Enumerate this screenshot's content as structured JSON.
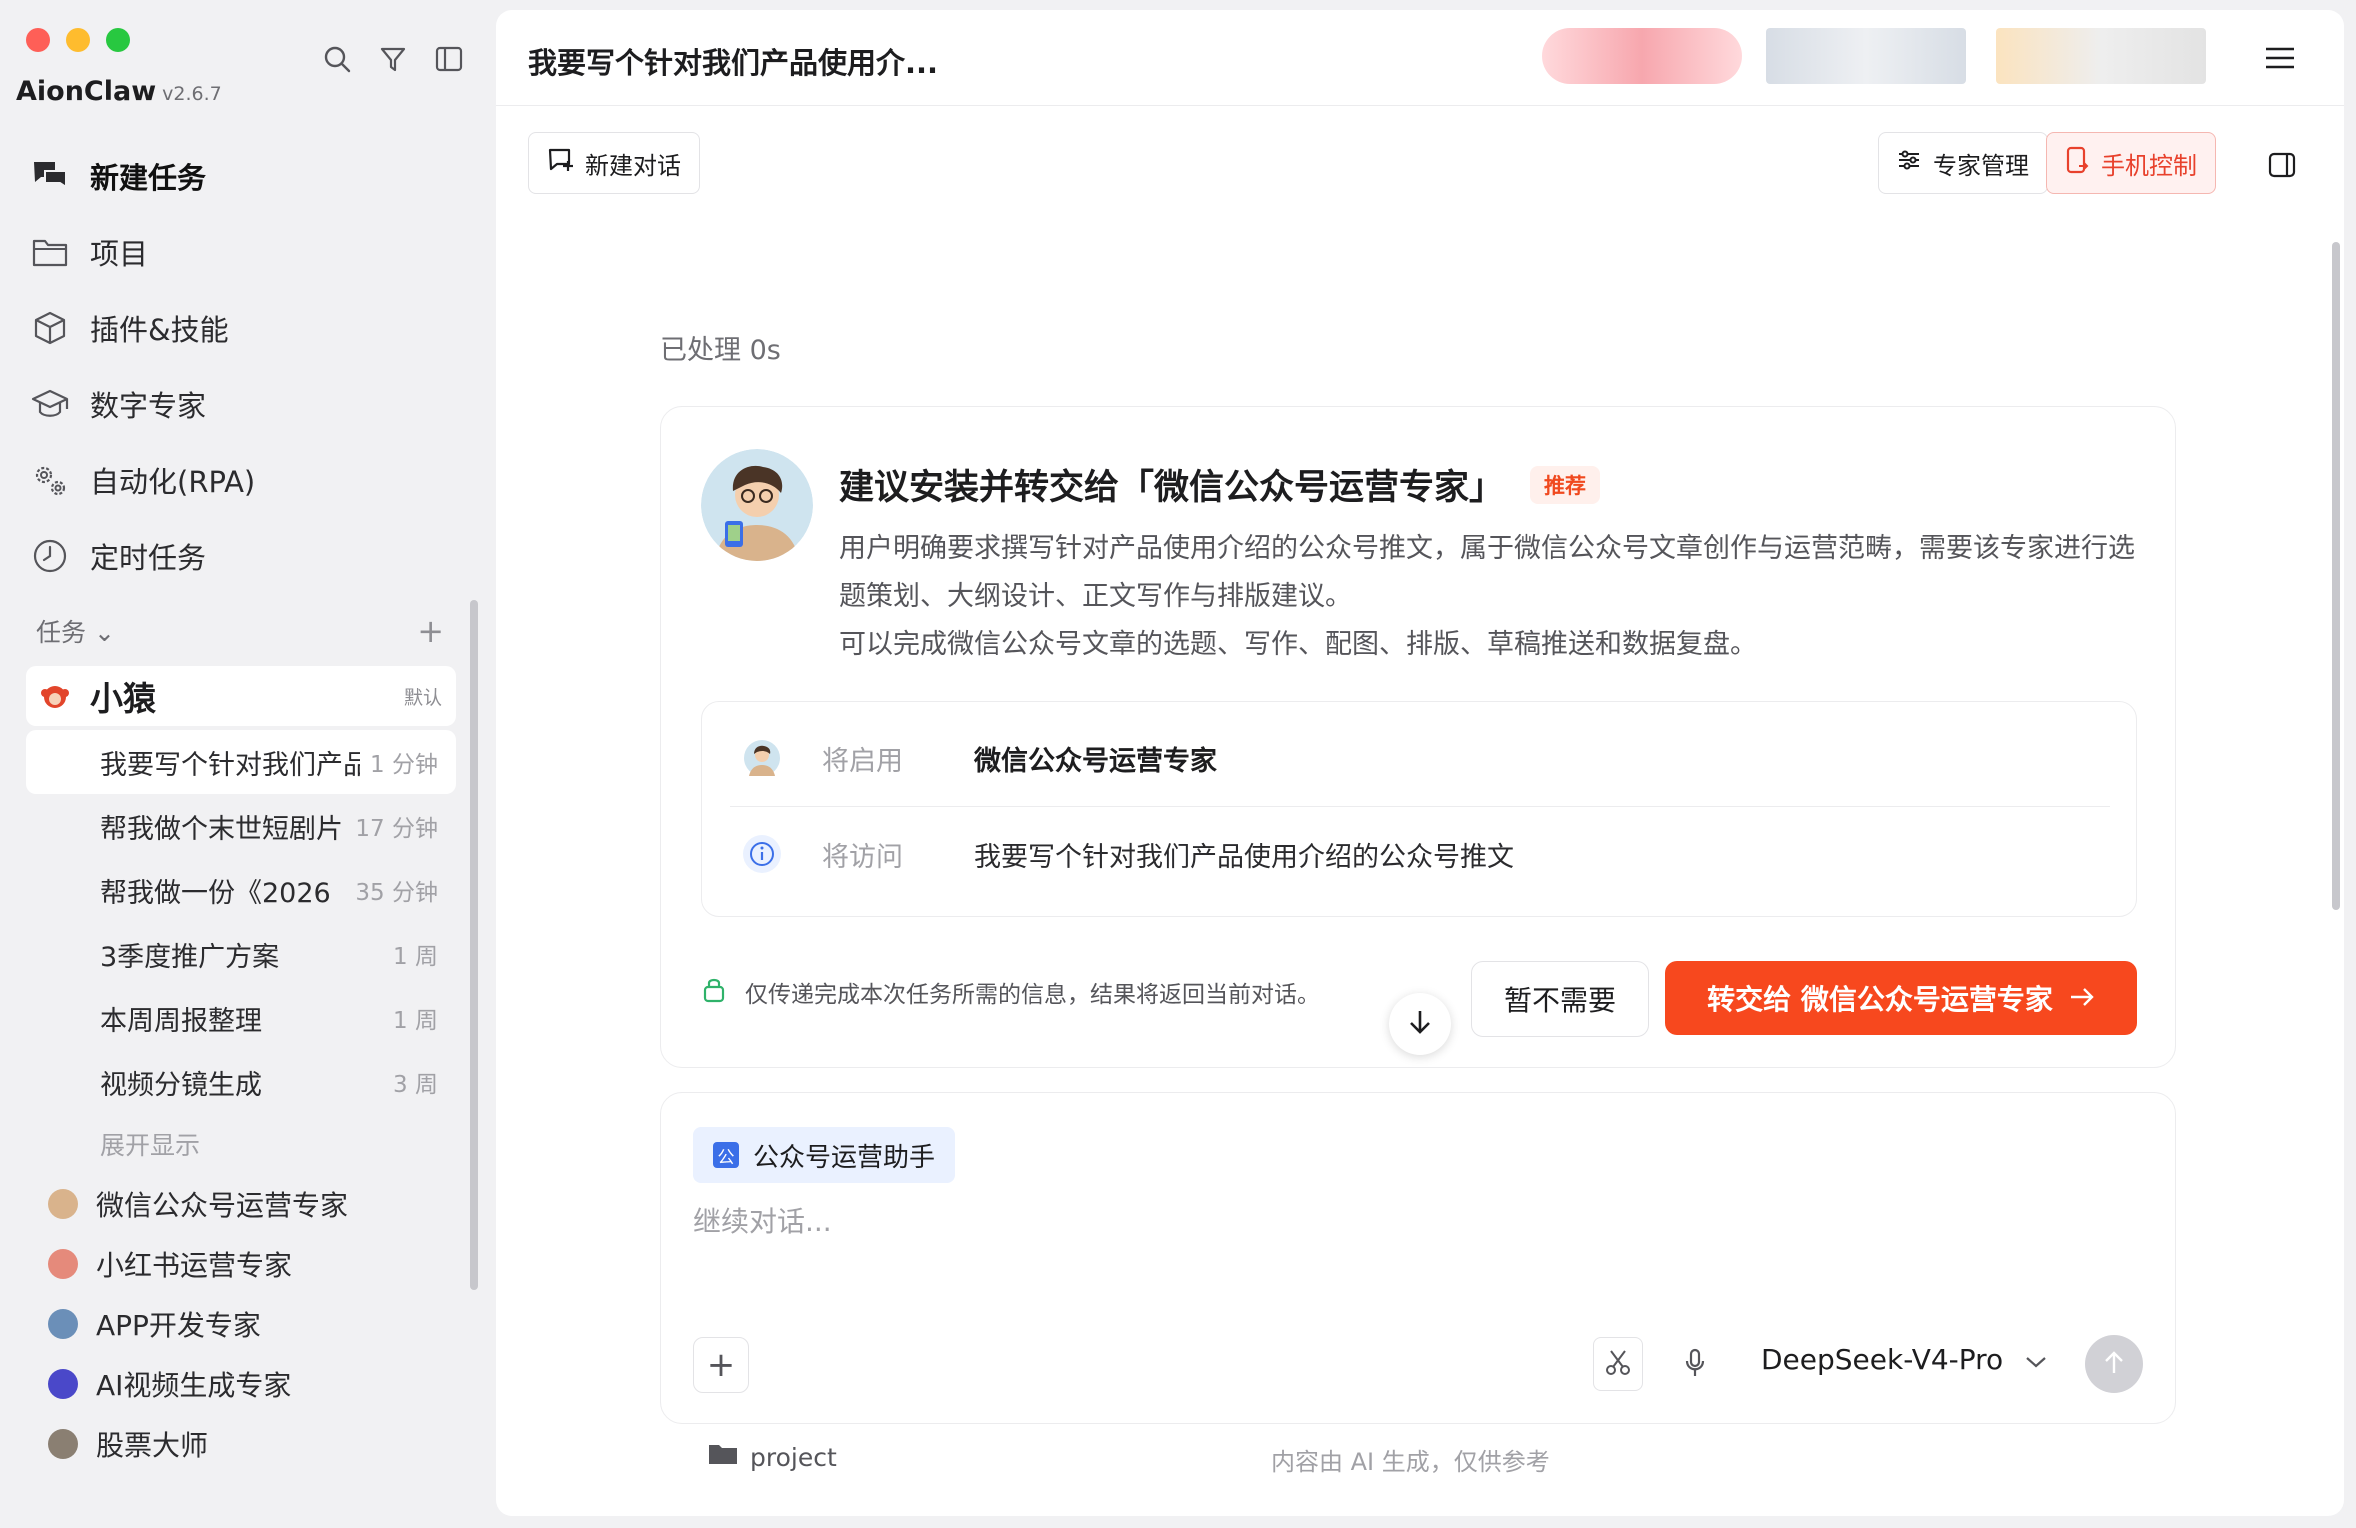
{
  "app": {
    "name": "AionClaw",
    "version": "v2.6.7"
  },
  "nav": [
    {
      "label": "新建任务",
      "icon": "chat-bubbles-icon"
    },
    {
      "label": "项目",
      "icon": "folder-icon"
    },
    {
      "label": "插件&技能",
      "icon": "cube-icon"
    },
    {
      "label": "数字专家",
      "icon": "graduation-cap-icon"
    },
    {
      "label": "自动化(RPA)",
      "icon": "gears-icon"
    },
    {
      "label": "定时任务",
      "icon": "clock-icon"
    }
  ],
  "tasks_section": {
    "title": "任务"
  },
  "group": {
    "name": "小猿",
    "tag": "默认"
  },
  "tasks": [
    {
      "name": "我要写个针对我们产品",
      "time": "1 分钟"
    },
    {
      "name": "帮我做个末世短剧片",
      "time": "17 分钟"
    },
    {
      "name": "帮我做一份《2026",
      "time": "35 分钟"
    },
    {
      "name": "3季度推广方案",
      "time": "1 周"
    },
    {
      "name": "本周周报整理",
      "time": "1 周"
    },
    {
      "name": "视频分镜生成",
      "time": "3 周"
    }
  ],
  "expand_label": "展开显示",
  "experts": [
    {
      "name": "微信公众号运营专家",
      "color": "#d9b38c"
    },
    {
      "name": "小红书运营专家",
      "color": "#e58a7b"
    },
    {
      "name": "APP开发专家",
      "color": "#6b8fb8"
    },
    {
      "name": "AI视频生成专家",
      "color": "#4a48c9"
    },
    {
      "name": "股票大师",
      "color": "#8a7f72"
    }
  ],
  "conversation": {
    "title": "我要写个针对我们产品使用介..."
  },
  "toolbar": {
    "new_chat": "新建对话",
    "expert_manage": "专家管理",
    "phone_control": "手机控制"
  },
  "processed": "已处理 0s",
  "card": {
    "title": "建议安装并转交给「微信公众号运营专家」",
    "badge": "推荐",
    "desc1": "用户明确要求撰写针对产品使用介绍的公众号推文，属于微信公众号文章创作与运营范畴，需要该专家进行选题策划、大纲设计、正文写作与排版建议。",
    "desc2": "可以完成微信公众号文章的选题、写作、配图、排版、草稿推送和数据复盘。",
    "enable_label": "将启用",
    "enable_value": "微信公众号运营专家",
    "visit_label": "将访问",
    "visit_value": "我要写个针对我们产品使用介绍的公众号推文",
    "privacy": "仅传递完成本次任务所需的信息，结果将返回当前对话。",
    "skip_button": "暂不需要",
    "transfer_button": "转交给 微信公众号运营专家"
  },
  "composer": {
    "chip": "公众号运营助手",
    "chip_icon": "公",
    "placeholder": "继续对话...",
    "model": "DeepSeek-V4-Pro"
  },
  "footer": {
    "project": "project",
    "note": "内容由 AI 生成，仅供参考"
  },
  "colors": {
    "accent": "#f7481e",
    "badge_bg": "#fff0ec",
    "chip_bg": "#eaf1ff",
    "phone_bg": "#fff1f0"
  }
}
